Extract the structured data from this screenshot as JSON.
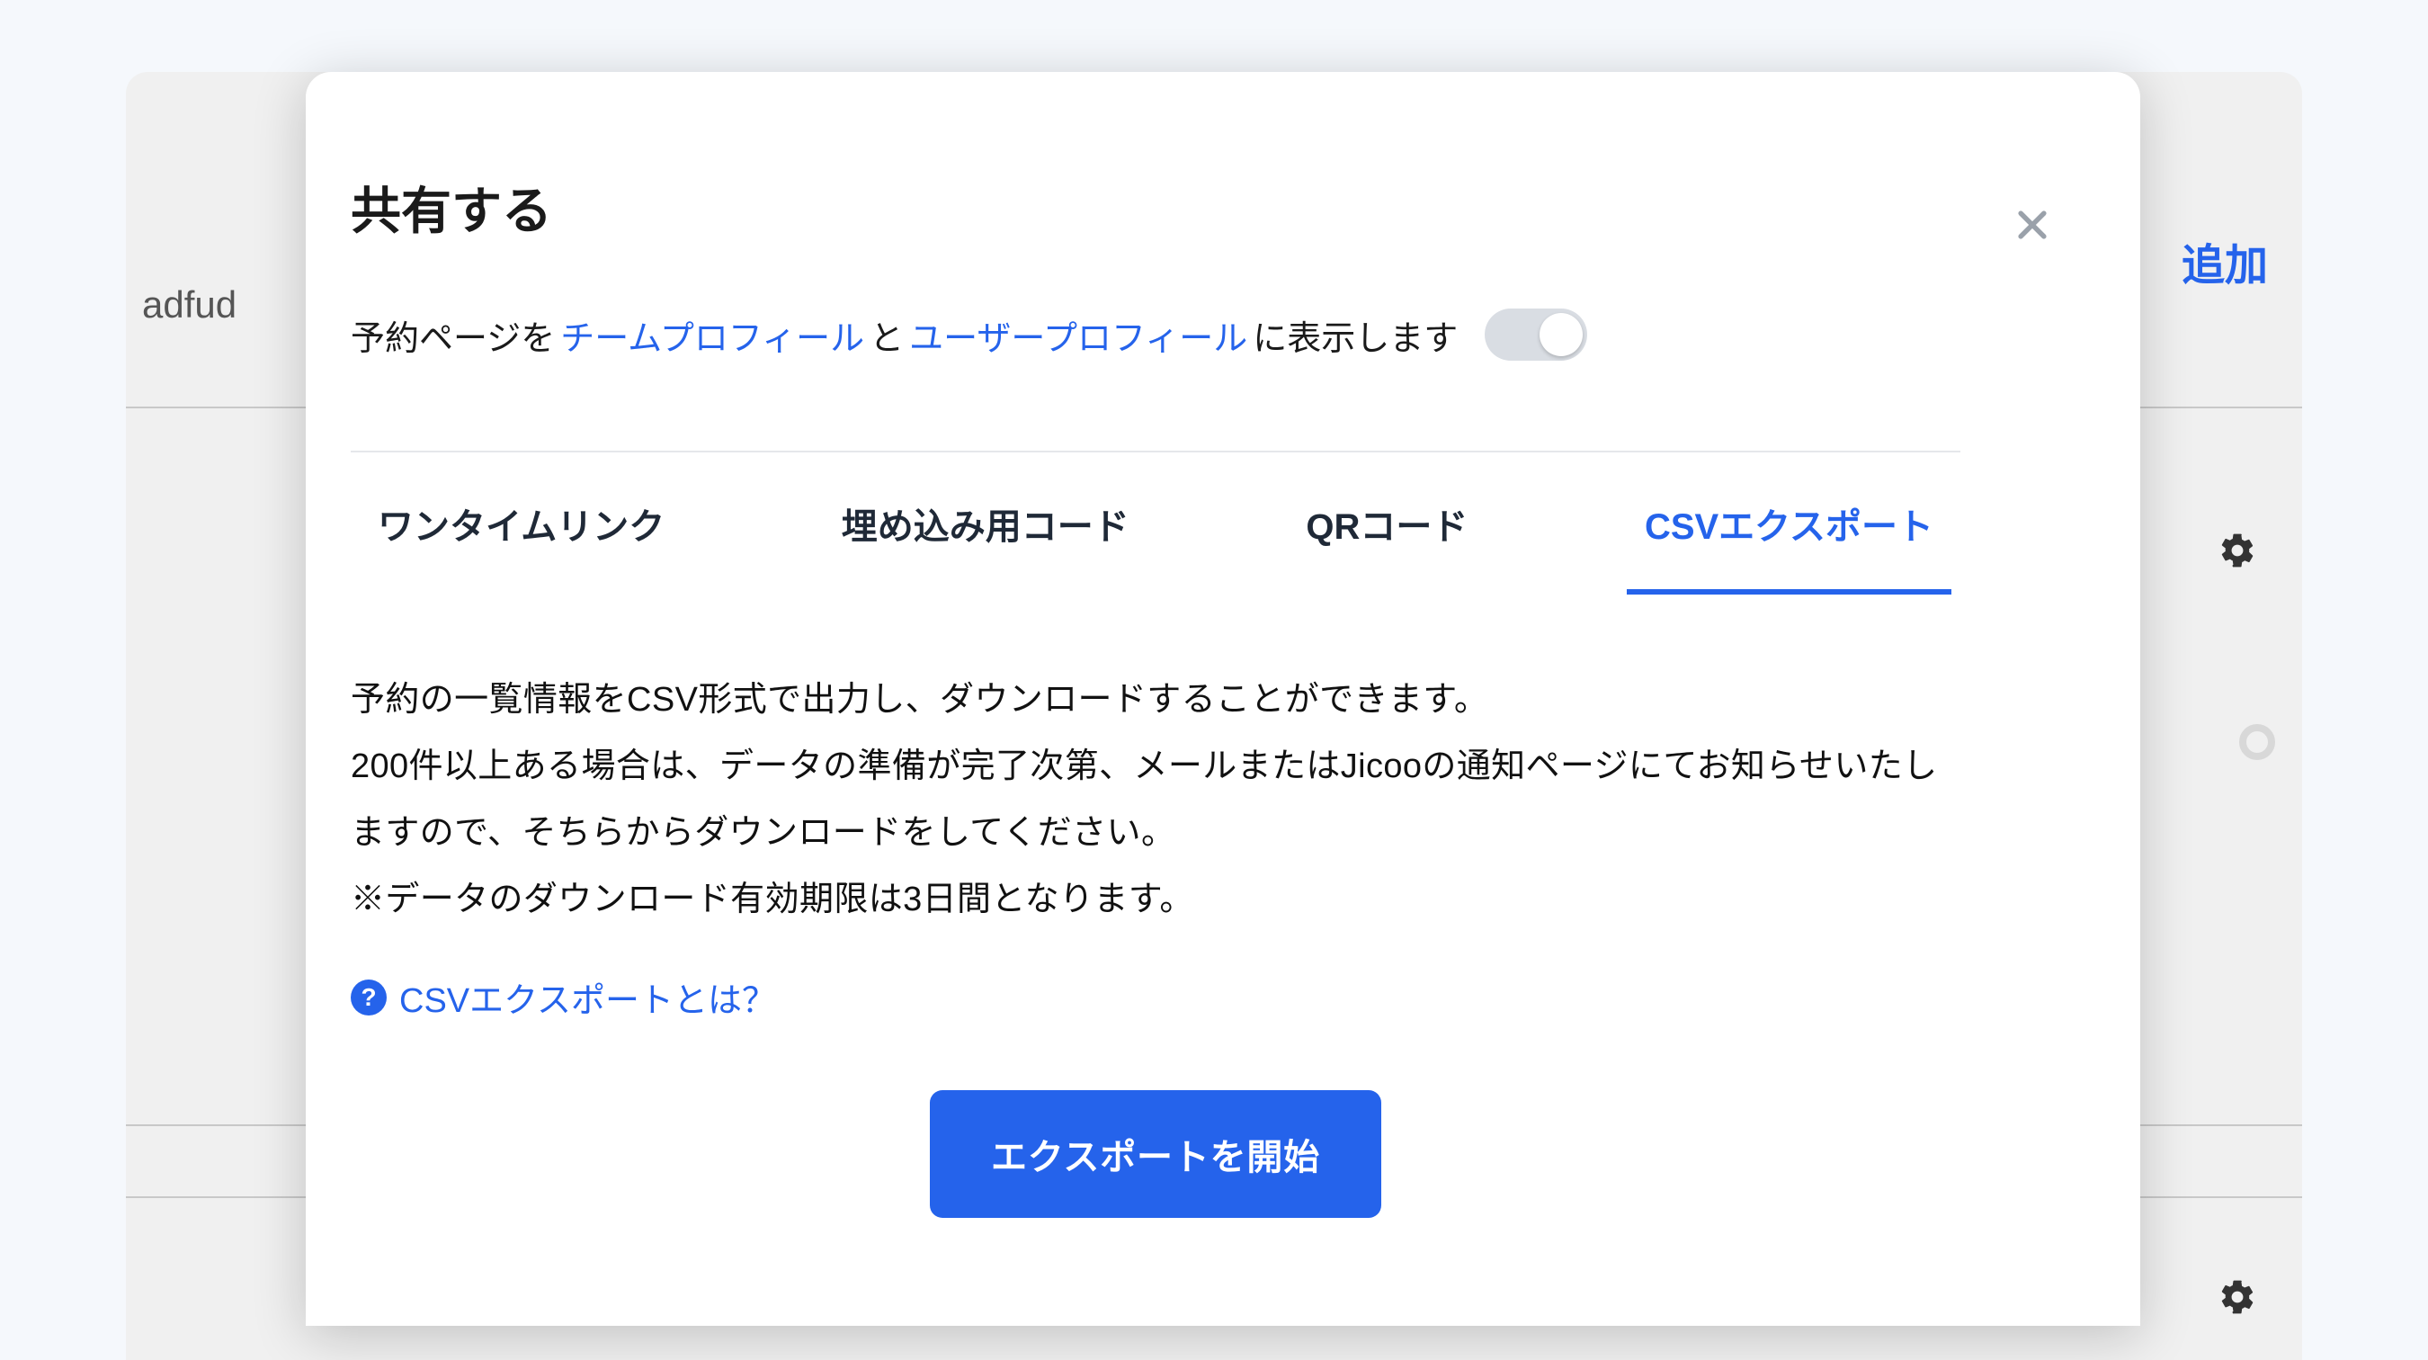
{
  "background": {
    "left_text": "adfud",
    "right_text": "追加"
  },
  "modal": {
    "title": "共有する",
    "profile_row": {
      "prefix_text": "予約ページを",
      "link_team": "チームプロフィール",
      "between": " と ",
      "link_user": "ユーザープロフィール",
      "suffix_text": "に表示します",
      "toggle_on": false
    },
    "tabs": [
      {
        "label": "ワンタイムリンク",
        "active": false
      },
      {
        "label": "埋め込み用コード",
        "active": false
      },
      {
        "label": "QRコード",
        "active": false
      },
      {
        "label": "CSVエクスポート",
        "active": true
      }
    ],
    "body_text": "予約の一覧情報をCSV形式で出力し、ダウンロードすることができます。\n200件以上ある場合は、データの準備が完了次第、メールまたはJicooの通知ページにてお知らせいたしますので、そちらからダウンロードをしてください。\n※データのダウンロード有効期限は3日間となります。",
    "help_link": "CSVエクスポートとは？",
    "export_button": "エクスポートを開始"
  }
}
